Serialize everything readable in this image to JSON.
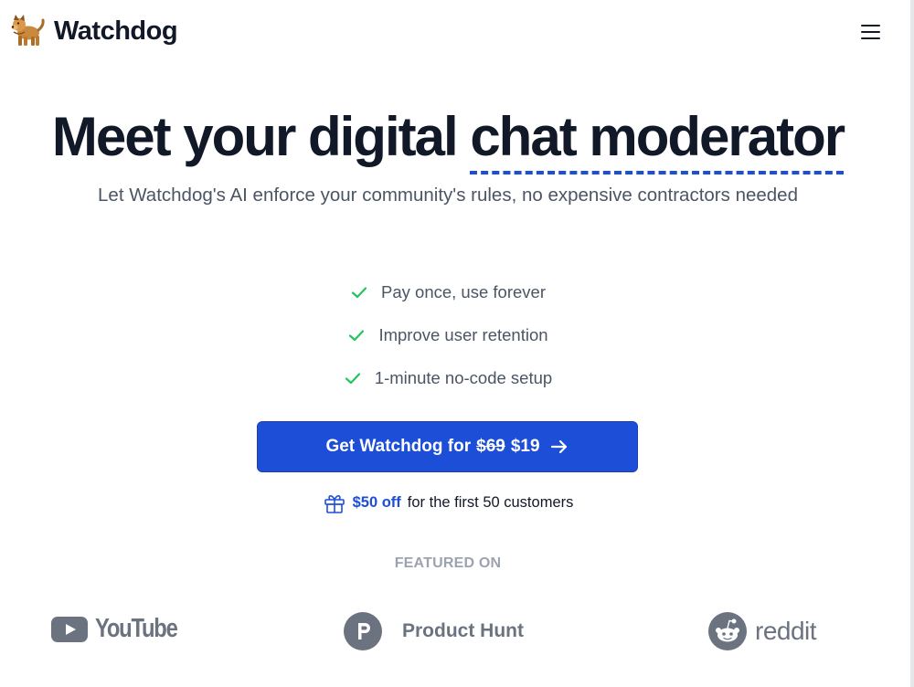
{
  "header": {
    "brand_name": "Watchdog",
    "brand_icon": "dog-icon",
    "menu_icon": "hamburger-menu-icon"
  },
  "hero": {
    "title_start": "Meet your digital ",
    "title_highlight": "chat moderator",
    "subtitle": "Let Watchdog's AI enforce your community's rules, no expensive contractors needed"
  },
  "features": [
    {
      "label": "Pay once, use forever",
      "icon": "check-icon"
    },
    {
      "label": "Improve user retention",
      "icon": "check-icon"
    },
    {
      "label": "1-minute no-code setup",
      "icon": "check-icon"
    }
  ],
  "cta": {
    "label": "Get Watchdog for",
    "old_price": "$69",
    "new_price": "$19",
    "icon": "arrow-right-icon"
  },
  "promo": {
    "icon": "gift-icon",
    "discount": "$50 off",
    "text": "for the first 50 customers"
  },
  "featured": {
    "label": "FEATURED ON",
    "logos": [
      {
        "name": "YouTube",
        "icon": "youtube-icon"
      },
      {
        "name": "Product Hunt",
        "icon": "product-hunt-icon"
      },
      {
        "name": "reddit",
        "icon": "reddit-icon"
      }
    ]
  },
  "colors": {
    "primary": "#1d4ed8",
    "text_dark": "#111827",
    "text_muted": "#4b5563",
    "check_green": "#22c55e",
    "logo_gray": "#6b7280"
  }
}
